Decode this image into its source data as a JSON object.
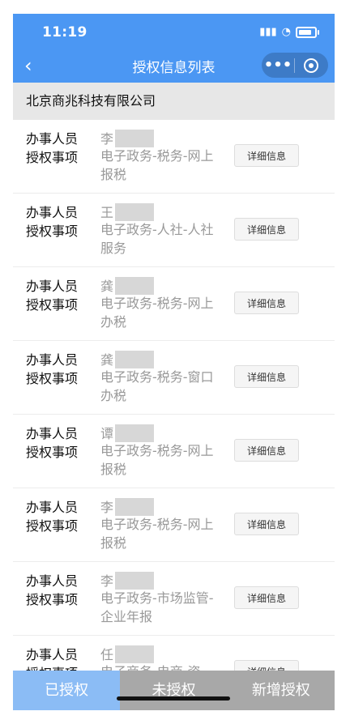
{
  "status": {
    "time": "11:19",
    "signal_icon": "signal-icon",
    "wifi_icon": "wifi-icon",
    "battery_icon": "battery-icon",
    "battery_level": 0.85
  },
  "nav": {
    "title": "授权信息列表",
    "back_icon": "back-arrow-icon",
    "more_icon": "more-dots-icon",
    "target_icon": "target-icon"
  },
  "company": "北京商兆科技有限公司",
  "labels": {
    "person": "办事人员",
    "matter": "授权事项",
    "detail_button": "详细信息"
  },
  "records": [
    {
      "name": "李",
      "matter": "电子政务-税务-网上报税"
    },
    {
      "name": "王",
      "matter": "电子政务-人社-人社服务"
    },
    {
      "name": "龚",
      "matter": "电子政务-税务-网上办税"
    },
    {
      "name": "龚",
      "matter": "电子政务-税务-窗口办税"
    },
    {
      "name": "谭",
      "matter": "电子政务-税务-网上报税"
    },
    {
      "name": "李",
      "matter": "电子政务-税务-网上报税"
    },
    {
      "name": "李",
      "matter": "电子政务-市场监管-企业年报"
    },
    {
      "name": "任",
      "matter": "电子商务-电商-资"
    }
  ],
  "tabs": [
    {
      "label": "已授权",
      "active": true
    },
    {
      "label": "未授权",
      "active": false
    },
    {
      "label": "新增授权",
      "active": false
    }
  ],
  "colors": {
    "nav_bg": "#4b97f3",
    "tab_active": "#8bbcf5",
    "tab_inactive": "#a8a8a8"
  }
}
